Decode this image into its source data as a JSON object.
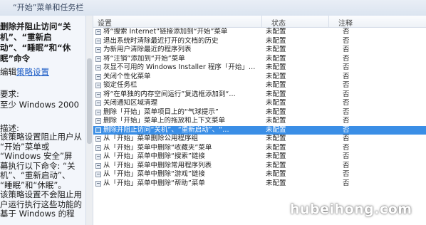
{
  "window": {
    "title": "“开始”菜单和任务栏"
  },
  "left_panel": {
    "heading": "删除并阻止访问“关机”、“重新启动”、“睡眠”和“休眠”命令",
    "edit_prefix": "编辑",
    "edit_link": "策略设置",
    "requirements_label": "要求:",
    "requirements_value": "至少 Windows 2000",
    "description_label": "描述:",
    "description_text": "该策略设置阻止用户从\n“开始”菜单或\n“Windows 安全”屏\n幕执行以下命令: “关\n机”、“重新启动”、\n“睡眠”和“休眠”。\n该策略设置不会阻止用\n户运行执行这些功能的\n基于 Windows 的程"
  },
  "list": {
    "columns": {
      "setting": "设置",
      "state": "状态",
      "note": "注释"
    },
    "rows": [
      {
        "setting": "将“搜索 Internet”链接添加到“开始”菜单",
        "state": "未配置",
        "note": "否"
      },
      {
        "setting": "退出系统时清除最近打开的文档的历史",
        "state": "未配置",
        "note": "否"
      },
      {
        "setting": "为新用户清除最近的程序列表",
        "state": "未配置",
        "note": "否"
      },
      {
        "setting": "将“注销”添加到“开始”菜单",
        "state": "未配置",
        "note": "否"
      },
      {
        "setting": "灰显不可用的 Windows Installer 程序「开始」…",
        "state": "未配置",
        "note": "否"
      },
      {
        "setting": "关闭个性化菜单",
        "state": "未配置",
        "note": "否"
      },
      {
        "setting": "锁定任务栏",
        "state": "未配置",
        "note": "否"
      },
      {
        "setting": "将“在单独的内存空间运行”复选框添加到“…",
        "state": "未配置",
        "note": "否"
      },
      {
        "setting": "关闭通知区域清理",
        "state": "未配置",
        "note": "否"
      },
      {
        "setting": "删除「开始」菜单项目上的“气球提示”",
        "state": "未配置",
        "note": "否"
      },
      {
        "setting": "删除「开始」菜单上的拖放和上下文菜单",
        "state": "未配置",
        "note": "否"
      },
      {
        "setting": "删除并阻止访问“关机”、“重新启动”、“…",
        "state": "未配置",
        "note": "否",
        "selected": true
      },
      {
        "setting": "从「开始」菜单删除公用程序组",
        "state": "未配置",
        "note": "否"
      },
      {
        "setting": "从「开始」菜单中删除“收藏夹”菜单",
        "state": "未配置",
        "note": "否"
      },
      {
        "setting": "从「开始」菜单中删除“搜索”链接",
        "state": "未配置",
        "note": "否"
      },
      {
        "setting": "从「开始」菜单中删除常用程序列表",
        "state": "未配置",
        "note": "否"
      },
      {
        "setting": "从「开始」菜单中删除“游戏”链接",
        "state": "未配置",
        "note": "否"
      },
      {
        "setting": "从「开始」菜单中删除“帮助”菜单",
        "state": "未配置",
        "note": "否"
      }
    ]
  },
  "watermark": "hubeihong.com",
  "colors": {
    "selection": "#3a8ee6",
    "link": "#1f5fc7"
  }
}
